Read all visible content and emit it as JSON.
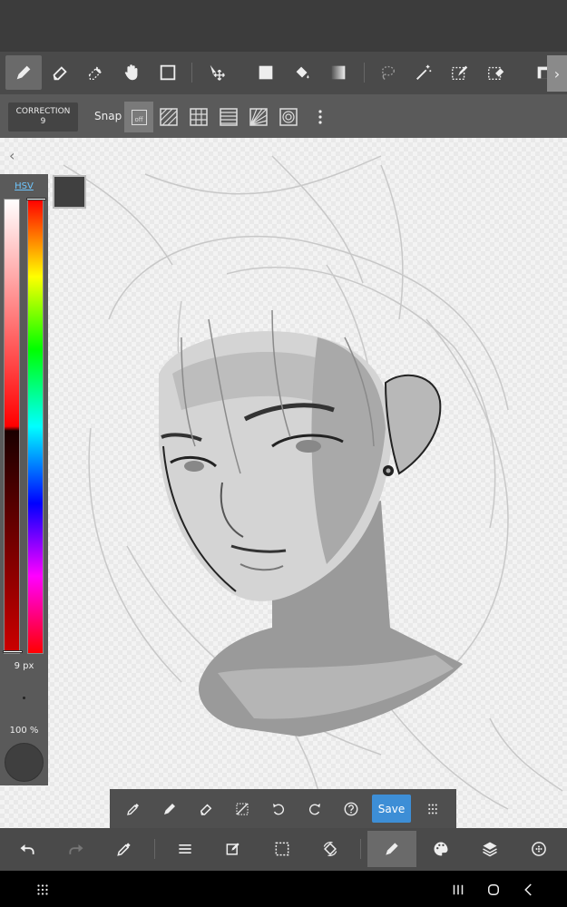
{
  "toolbar": {
    "tools": [
      {
        "name": "pen",
        "icon": "pen-icon",
        "active": true
      },
      {
        "name": "eraser",
        "icon": "eraser-icon"
      },
      {
        "name": "blur-eraser",
        "icon": "soft-eraser-icon"
      },
      {
        "name": "hand",
        "icon": "hand-icon"
      },
      {
        "name": "shape",
        "icon": "rectangle-icon"
      },
      {
        "name": "move",
        "icon": "move-icon"
      },
      {
        "name": "fill-rect",
        "icon": "filled-square-icon"
      },
      {
        "name": "bucket",
        "icon": "bucket-icon"
      },
      {
        "name": "gradient",
        "icon": "gradient-icon"
      },
      {
        "name": "lasso",
        "icon": "lasso-icon"
      },
      {
        "name": "magic-wand",
        "icon": "magic-wand-icon"
      },
      {
        "name": "select-pen",
        "icon": "select-pen-icon"
      },
      {
        "name": "select-eraser",
        "icon": "select-eraser-icon"
      },
      {
        "name": "layout",
        "icon": "layout-icon"
      }
    ]
  },
  "subbar": {
    "correction_label": "CORRECTION",
    "correction_value": "9",
    "snap_label": "Snap",
    "snap_off_label": "off"
  },
  "color_panel": {
    "mode_label": "HSV",
    "brush_size": "9 px",
    "opacity": "100 %",
    "current_color": "#404040"
  },
  "quickbar": {
    "save_label": "Save"
  },
  "colors": {
    "accent": "#3d8ed6",
    "hsv_label": "#6ec6ff",
    "toolbar_bg": "#4a4a4a"
  }
}
